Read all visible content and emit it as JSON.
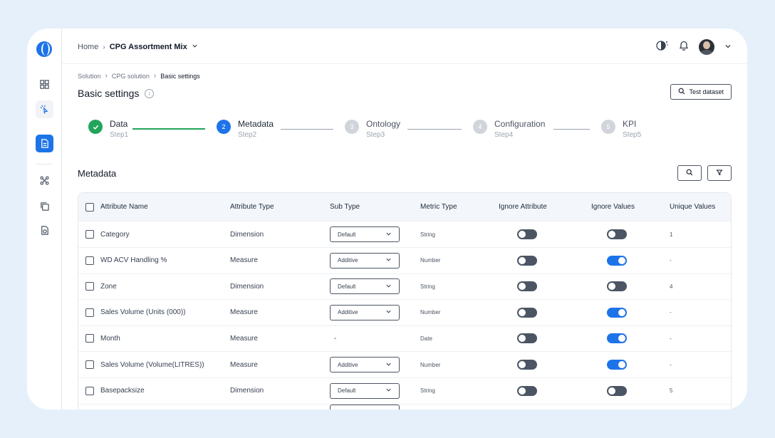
{
  "topbar": {
    "home": "Home",
    "project": "CPG Assortment Mix"
  },
  "breadcrumb": [
    "Solution",
    "CPG solution",
    "Basic settings"
  ],
  "page": {
    "title": "Basic settings",
    "info_glyph": "i",
    "test_dataset_label": "Test dataset"
  },
  "steps": [
    {
      "title": "Data",
      "sub": "Step1",
      "status": "done",
      "num": ""
    },
    {
      "title": "Metadata",
      "sub": "Step2",
      "status": "current",
      "num": "2"
    },
    {
      "title": "Ontology",
      "sub": "Step3",
      "status": "todo",
      "num": "3"
    },
    {
      "title": "Configuration",
      "sub": "Step4",
      "status": "todo",
      "num": "4"
    },
    {
      "title": "KPI",
      "sub": "Step5",
      "status": "todo",
      "num": "5"
    }
  ],
  "section": {
    "title": "Metadata"
  },
  "table": {
    "columns": [
      "Attribute Name",
      "Attribute Type",
      "Sub Type",
      "Metric Type",
      "Ignore Attribute",
      "Ignore Values",
      "Unique Values"
    ],
    "rows": [
      {
        "name": "Category",
        "type": "Dimension",
        "subtype": "Default",
        "metric": "String",
        "ignore_attr": false,
        "ignore_vals": false,
        "unique": "1"
      },
      {
        "name": "WD ACV Handling %",
        "type": "Measure",
        "subtype": "Additive",
        "metric": "Number",
        "ignore_attr": false,
        "ignore_vals": true,
        "unique": "-"
      },
      {
        "name": "Zone",
        "type": "Dimension",
        "subtype": "Default",
        "metric": "String",
        "ignore_attr": false,
        "ignore_vals": false,
        "unique": "4"
      },
      {
        "name": "Sales Volume (Units (000))",
        "type": "Measure",
        "subtype": "Additive",
        "metric": "Number",
        "ignore_attr": false,
        "ignore_vals": true,
        "unique": "-"
      },
      {
        "name": "Month",
        "type": "Measure",
        "subtype": "-",
        "metric": "Date",
        "ignore_attr": false,
        "ignore_vals": true,
        "unique": "-"
      },
      {
        "name": "Sales Volume (Volume(LITRES))",
        "type": "Measure",
        "subtype": "Additive",
        "metric": "Number",
        "ignore_attr": false,
        "ignore_vals": true,
        "unique": "-"
      },
      {
        "name": "Basepacksize",
        "type": "Dimension",
        "subtype": "Default",
        "metric": "String",
        "ignore_attr": false,
        "ignore_vals": false,
        "unique": "5"
      }
    ]
  },
  "colors": {
    "accent": "#1d73e8",
    "success": "#22a55b",
    "toggle_off": "#4b5563",
    "page_bg": "#e6f0fb"
  }
}
